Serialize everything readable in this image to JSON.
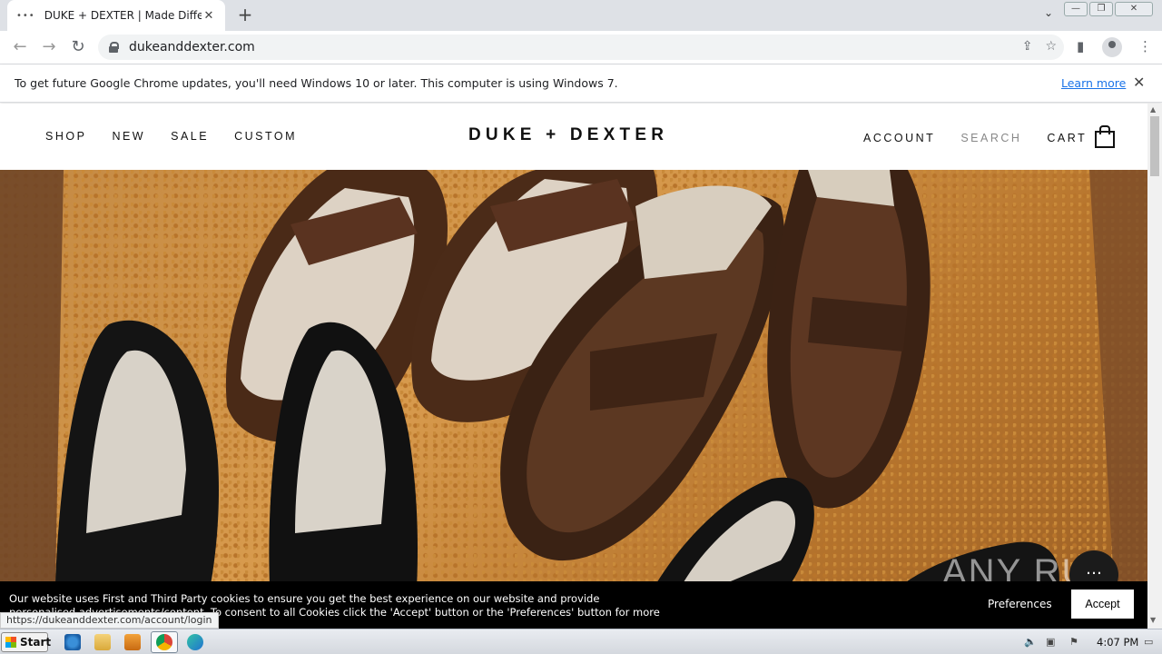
{
  "browser": {
    "tab_title": "DUKE + DEXTER | Made Different",
    "tab_favicon": "•••",
    "new_tab": "+",
    "tab_search": "⌄",
    "url": "dukeanddexter.com",
    "window_controls": {
      "minimize": "—",
      "maximize": "❐",
      "close": "✕"
    }
  },
  "infobar": {
    "message": "To get future Google Chrome updates, you'll need Windows 10 or later. This computer is using Windows 7.",
    "link": "Learn more",
    "close": "✕"
  },
  "site": {
    "nav_left": [
      "SHOP",
      "NEW",
      "SALE",
      "CUSTOM"
    ],
    "logo": "DUKE + DEXTER",
    "nav_right": {
      "account": "ACCOUNT",
      "search": "SEARCH",
      "cart": "CART"
    },
    "hero_alt": "Leather penny loafers in brown, black and cream",
    "cookie": {
      "text": "Our website uses First and Third Party cookies to ensure you get the best experience on our website and provide personalised advertisements/content. To consent to all Cookies click the 'Accept' button or the 'Preferences' button for more information.",
      "preferences": "Preferences",
      "accept": "Accept"
    },
    "watermark": "ANY RUN"
  },
  "status_url": "https://dukeanddexter.com/account/login",
  "taskbar": {
    "start": "Start",
    "time": "4:07 PM"
  },
  "colors": {
    "brand": "#111111",
    "link": "#1a73e8",
    "cookie_bg": "#000000"
  }
}
